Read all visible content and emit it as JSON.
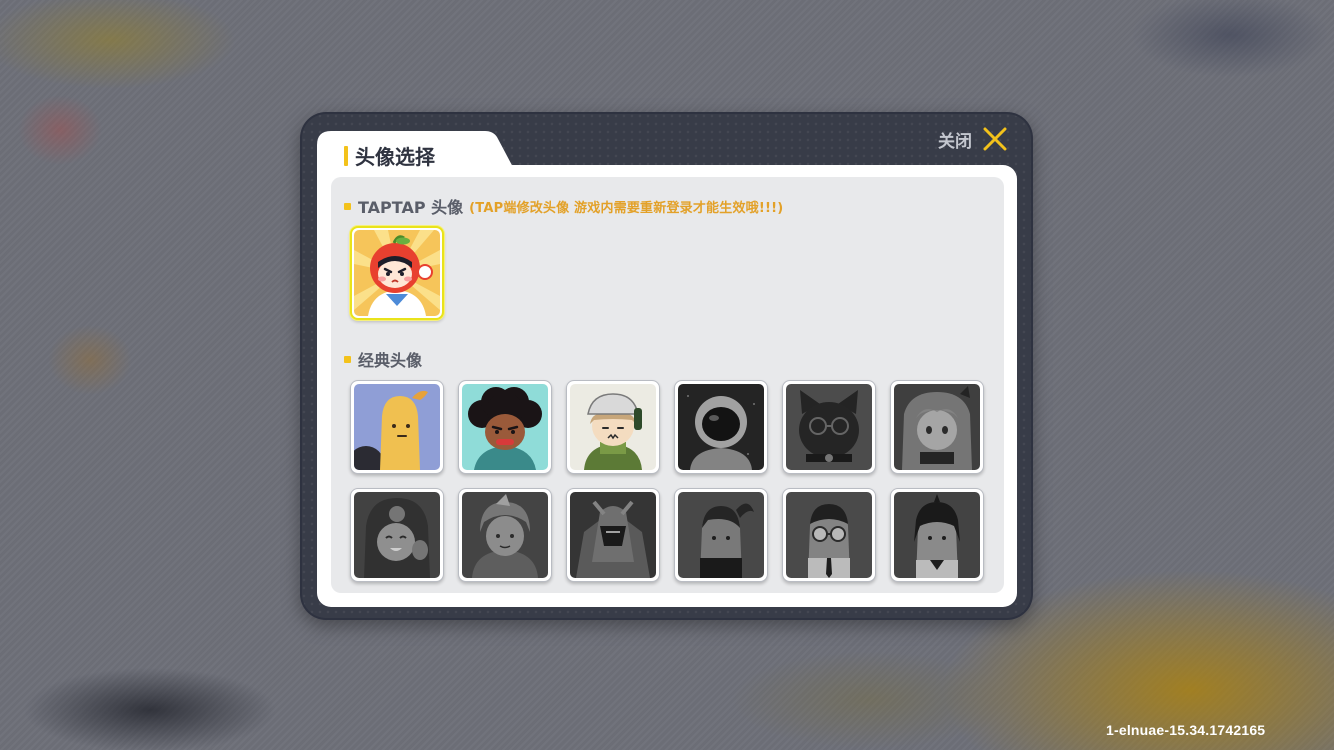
{
  "dialog": {
    "title": "头像选择",
    "close_label": "关闭"
  },
  "taptap_section": {
    "title": "TAPTAP 头像",
    "note": "(TAP端修改头像 游戏内需要重新登录才能生效哦!!!)",
    "avatars": [
      {
        "icon": "apple-girl-avatar",
        "selected": true,
        "unlocked": true
      }
    ]
  },
  "classic_section": {
    "title": "经典头像",
    "avatars": [
      {
        "icon": "banana-avatar",
        "unlocked": true
      },
      {
        "icon": "afro-man-avatar",
        "unlocked": true
      },
      {
        "icon": "green-hat-girl-avatar",
        "unlocked": true
      },
      {
        "icon": "astronaut-avatar",
        "unlocked": false
      },
      {
        "icon": "cat-glasses-avatar",
        "unlocked": false
      },
      {
        "icon": "anime-girl-avatar",
        "unlocked": false
      },
      {
        "icon": "hooded-boy-avatar",
        "unlocked": false
      },
      {
        "icon": "warrior-avatar",
        "unlocked": false
      },
      {
        "icon": "robot-knight-avatar",
        "unlocked": false
      },
      {
        "icon": "ponytail-girl-avatar",
        "unlocked": false
      },
      {
        "icon": "glasses-man-avatar",
        "unlocked": false
      },
      {
        "icon": "bob-hair-girl-avatar",
        "unlocked": false
      }
    ]
  },
  "footer": {
    "version": "1-elnuae-15.34.1742165"
  },
  "colors": {
    "accent_yellow": "#f3c21b",
    "note_orange": "#e3a128",
    "dialog_dark": "#383c48",
    "panel_gray": "#e8e9eb"
  }
}
